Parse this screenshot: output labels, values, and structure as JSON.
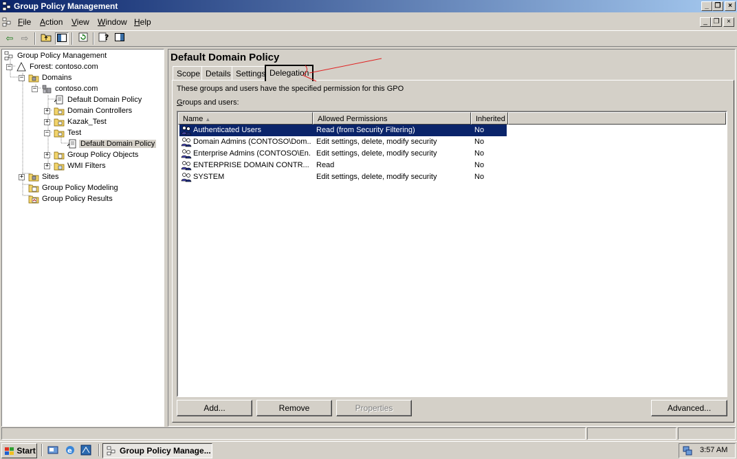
{
  "window": {
    "title": "Group Policy Management"
  },
  "menu": [
    {
      "label": "File",
      "key": "F",
      "rest": "ile"
    },
    {
      "label": "Action",
      "key": "A",
      "rest": "ction"
    },
    {
      "label": "View",
      "key": "V",
      "rest": "iew"
    },
    {
      "label": "Window",
      "key": "W",
      "rest": "indow"
    },
    {
      "label": "Help",
      "key": "H",
      "rest": "elp"
    }
  ],
  "tree": {
    "root": "Group Policy Management",
    "forest": "Forest: contoso.com",
    "domains": "Domains",
    "domain": "contoso.com",
    "default_policy": "Default Domain Policy",
    "domain_controllers": "Domain Controllers",
    "kazak_test": "Kazak_Test",
    "test": "Test",
    "test_policy": "Default Domain Policy",
    "gpo": "Group Policy Objects",
    "wmi": "WMI Filters",
    "sites": "Sites",
    "modeling": "Group Policy Modeling",
    "results": "Group Policy Results"
  },
  "details": {
    "title": "Default Domain Policy",
    "tabs": [
      "Scope",
      "Details",
      "Settings",
      "Delegation"
    ],
    "active_tab": "Delegation",
    "description": "These groups and users have the specified permission for this GPO",
    "groups_label_key": "G",
    "groups_label_rest": "roups and users:",
    "columns": [
      "Name",
      "Allowed Permissions",
      "Inherited"
    ],
    "rows": [
      {
        "name": "Authenticated Users",
        "perm": "Read (from Security Filtering)",
        "inherited": "No",
        "selected": true
      },
      {
        "name": "Domain Admins (CONTOSO\\Dom...",
        "perm": "Edit settings, delete, modify security",
        "inherited": "No"
      },
      {
        "name": "Enterprise Admins (CONTOSO\\En...",
        "perm": "Edit settings, delete, modify security",
        "inherited": "No"
      },
      {
        "name": "ENTERPRISE DOMAIN CONTR...",
        "perm": "Read",
        "inherited": "No"
      },
      {
        "name": "SYSTEM",
        "perm": "Edit settings, delete, modify security",
        "inherited": "No"
      }
    ],
    "buttons": {
      "add": "Add...",
      "remove": "Remove",
      "properties": "Properties",
      "advanced": "Advanced..."
    }
  },
  "taskbar": {
    "start": "Start",
    "task": "Group Policy Manage...",
    "clock": "3:57 AM"
  },
  "colors": {
    "title_start": "#0a246a",
    "title_end": "#a6caf0",
    "selection": "#0a246a",
    "annotation": "#e02020"
  }
}
